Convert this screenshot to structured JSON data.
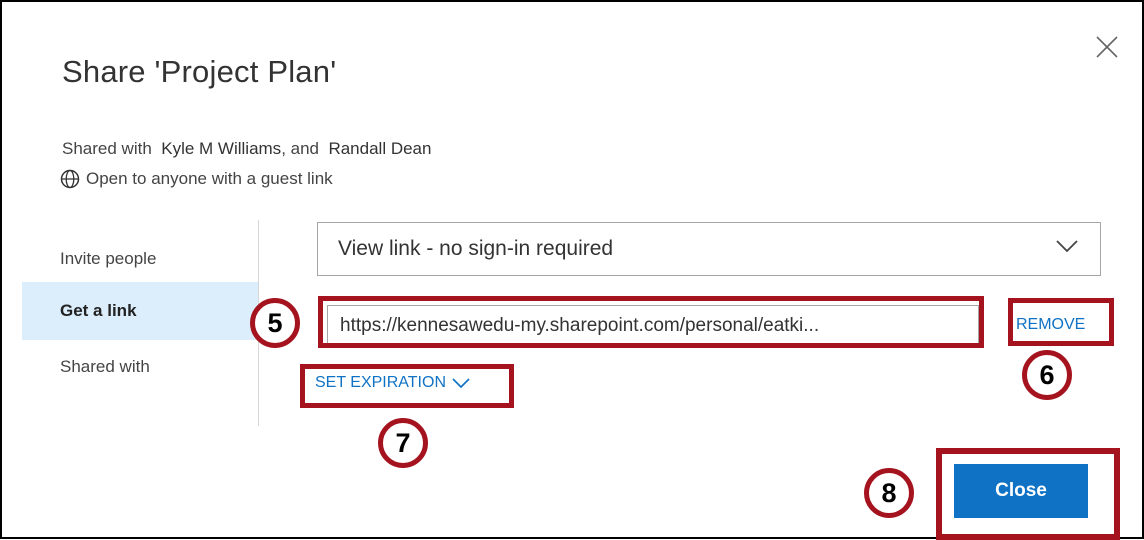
{
  "dialog": {
    "title": "Share 'Project Plan'",
    "shared_prefix": "Shared with",
    "shared_people": [
      "Kyle M Williams",
      "Randall Dean"
    ],
    "shared_joiner": ", and",
    "guest_link_text": "Open to anyone with a guest link",
    "close_icon": "close-icon"
  },
  "sidebar": {
    "items": [
      {
        "label": "Invite people",
        "active": false
      },
      {
        "label": "Get a link",
        "active": true
      },
      {
        "label": "Shared with",
        "active": false
      }
    ]
  },
  "link_panel": {
    "link_type": "View link - no sign-in required",
    "url": "https://kennesawedu-my.sharepoint.com/personal/eatki...",
    "remove_label": "REMOVE",
    "set_expiration_label": "SET EXPIRATION"
  },
  "footer": {
    "close_label": "Close"
  },
  "callouts": {
    "url_box": "5",
    "remove": "6",
    "set_expiration": "7",
    "close_button": "8"
  },
  "colors": {
    "accent": "#0f72c5",
    "highlight": "#a5141e",
    "active_nav": "#dceefb"
  }
}
